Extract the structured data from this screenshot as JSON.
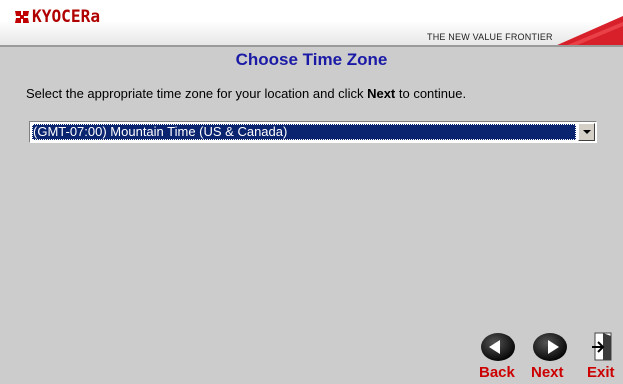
{
  "header": {
    "logo_text": "KYOCERa",
    "tagline": "THE NEW VALUE FRONTIER"
  },
  "page_title": "Choose Time Zone",
  "instruction": {
    "before": "Select the appropriate time zone for your location and click ",
    "emphasis": "Next",
    "after": " to continue."
  },
  "timezone_select": {
    "selected": "(GMT-07:00) Mountain Time (US & Canada)"
  },
  "nav": {
    "back_label": "Back",
    "next_label": "Next",
    "exit_label": "Exit"
  },
  "colors": {
    "brand_red": "#cc0000",
    "title_blue": "#1a1aa6",
    "selection_navy": "#0a2470",
    "background": "#cccccc"
  },
  "icons": [
    "kyocera-logo-icon",
    "back-arrow-icon",
    "next-arrow-icon",
    "exit-door-icon",
    "chevron-down-icon"
  ]
}
